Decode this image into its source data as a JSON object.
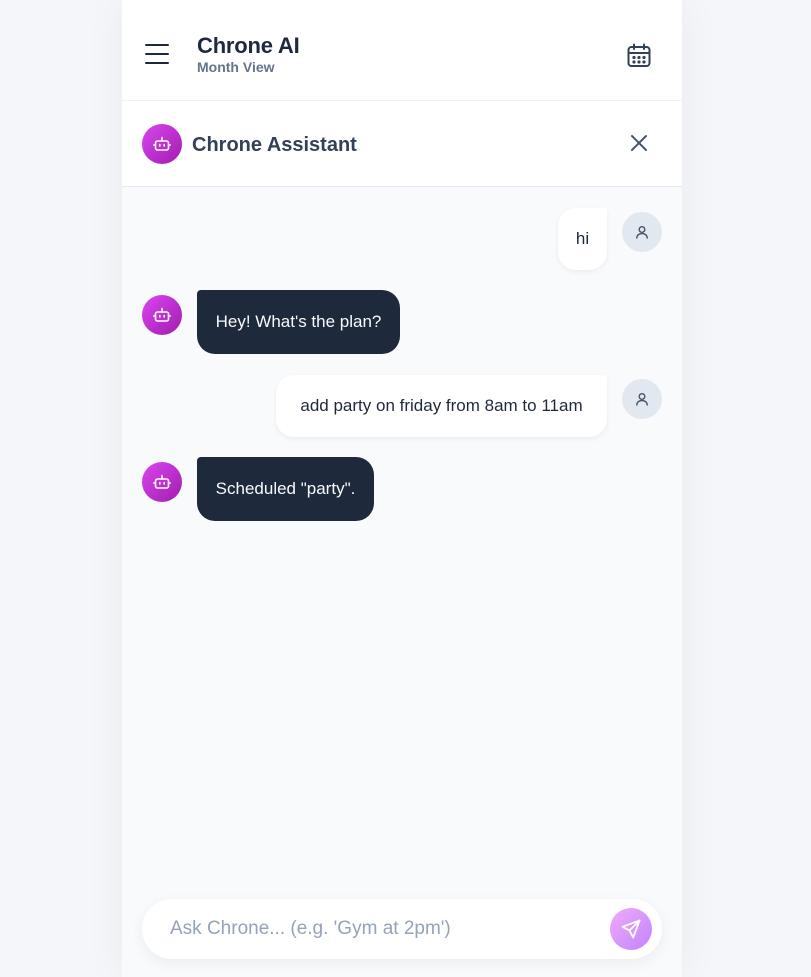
{
  "header": {
    "title": "Chrone AI",
    "subtitle": "Month View",
    "menu_icon": "hamburger-menu-icon",
    "calendar_icon": "calendar-icon"
  },
  "assistant": {
    "name": "Chrone Assistant",
    "avatar_icon": "robot-icon",
    "close_icon": "close-icon"
  },
  "messages": [
    {
      "role": "user",
      "text": "hi"
    },
    {
      "role": "assistant",
      "text": "Hey! What's the plan?"
    },
    {
      "role": "user",
      "text": "add party on friday from 8am to 11am"
    },
    {
      "role": "assistant",
      "text": "Scheduled \"party\"."
    }
  ],
  "composer": {
    "placeholder": "Ask Chrone... (e.g. 'Gym at 2pm')",
    "value": "",
    "send_icon": "send-icon"
  },
  "colors": {
    "accent_gradient_start": "#d946ef",
    "accent_gradient_end": "#a21caf",
    "bot_bubble": "#1e293b",
    "user_bubble": "#ffffff"
  }
}
